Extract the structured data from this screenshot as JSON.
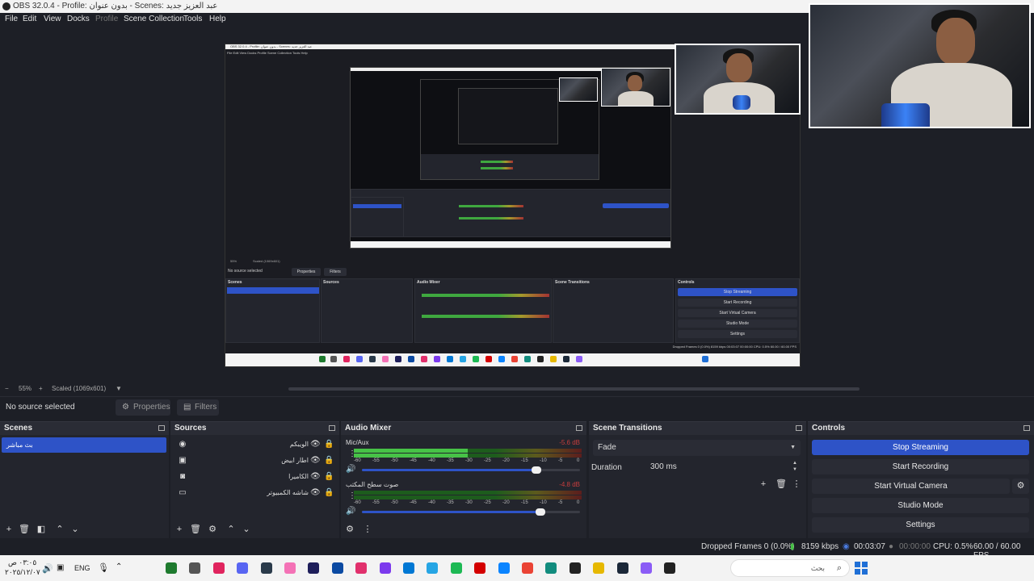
{
  "window": {
    "title": "OBS 32.0.4 - Profile: بدون عنوان - Scenes: عبد العزيز جديد"
  },
  "menu": {
    "items": [
      "File",
      "Edit",
      "View",
      "Docks",
      "Profile",
      "Scene Collection",
      "Tools",
      "Help"
    ],
    "disabled": [
      "Profile"
    ]
  },
  "preview": {
    "zoom": "55%",
    "scale_label": "Scaled (1069x601)",
    "nested_title": "OBS 32.0.4 - Profile: بدون عنوان - Scenes: عبد العزيز جديد",
    "nested_zoom": "55%",
    "nested_scale": "Scaled (1069x601)",
    "nested_no_source": "No source selected",
    "nested_properties": "Properties",
    "nested_filters": "Filters",
    "nested_controls": [
      "Stop Streaming",
      "Start Recording",
      "Start Virtual Camera",
      "Studio Mode",
      "Settings"
    ],
    "nested_status": "Dropped Frames 0 (0.0%)   8159 kbps   00:03:07   00:00:00   CPU: 0.5%   60.00 / 60.00 FPS"
  },
  "props_bar": {
    "no_source": "No source selected",
    "properties": "Properties",
    "filters": "Filters"
  },
  "scenes": {
    "title": "Scenes",
    "items": [
      "بث مباشر"
    ]
  },
  "sources": {
    "title": "Sources",
    "items": [
      {
        "name": "الويبكم",
        "icon": "browser-icon"
      },
      {
        "name": "اطار ابيض",
        "icon": "image-icon"
      },
      {
        "name": "الكاميرا",
        "icon": "camera-icon"
      },
      {
        "name": "شاشه الكمبيوتر",
        "icon": "monitor-icon"
      }
    ]
  },
  "mixer": {
    "title": "Audio Mixer",
    "ticks": [
      "-60",
      "-55",
      "-50",
      "-45",
      "-40",
      "-35",
      "-30",
      "-25",
      "-20",
      "-15",
      "-10",
      "-5",
      "0"
    ],
    "channels": [
      {
        "name": "Mic/Aux",
        "db": "-5.6 dB",
        "level": 0.5,
        "volume": 0.8
      },
      {
        "name": "صوت سطح المكتب",
        "db": "-4.8 dB",
        "level": 0.0,
        "volume": 0.82
      }
    ]
  },
  "transitions": {
    "title": "Scene Transitions",
    "selected": "Fade",
    "duration_label": "Duration",
    "duration_value": "300 ms"
  },
  "controls": {
    "title": "Controls",
    "stop_streaming": "Stop Streaming",
    "start_recording": "Start Recording",
    "start_virtual_camera": "Start Virtual Camera",
    "studio_mode": "Studio Mode",
    "settings": "Settings"
  },
  "status": {
    "dropped": "Dropped Frames 0 (0.0%)",
    "kbps": "8159 kbps",
    "stream_time": "00:03:07",
    "rec_time": "00:00:00",
    "cpu": "CPU: 0.5%",
    "fps": "60.00 / 60.00 FPS"
  },
  "taskbar": {
    "time": "٠٣:٠٥ ص",
    "date": "٢٠٢٥/١٢/٠٧",
    "lang": "ENG",
    "search_placeholder": "بحث",
    "apps": [
      "#1e7a2e",
      "#555",
      "#e0245e",
      "#5865f2",
      "#2a3a4a",
      "#f472b6",
      "#1e1e5a",
      "#0b4aa2",
      "#e1306c",
      "#7c3aed",
      "#0078d4",
      "#26a5e4",
      "#1db954",
      "#d40000",
      "#0a84ff",
      "#ea4335",
      "#128c7e",
      "#222",
      "#e6b800",
      "#1b2838",
      "#8b5cf6",
      "#222"
    ]
  },
  "colors": {
    "accent": "#2e53c7",
    "panel": "#23252d",
    "background": "#1d1f26",
    "meter_green": "#47c247",
    "meter_yellow": "#a39a2c",
    "meter_red": "#c63d3d",
    "db_text": "#c63d3d"
  }
}
